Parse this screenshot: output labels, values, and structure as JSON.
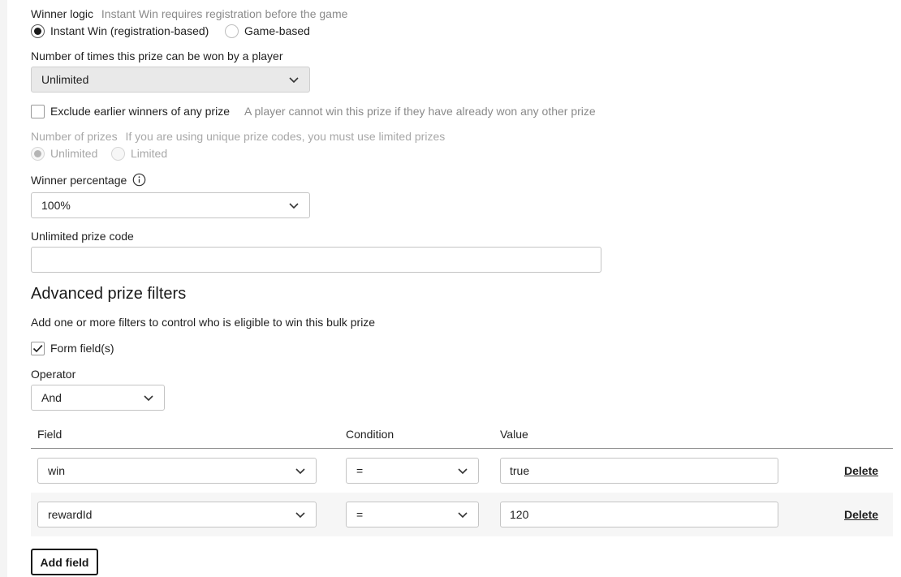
{
  "winner_logic": {
    "label": "Winner logic",
    "hint": "Instant Win requires registration before the game",
    "options": [
      "Instant Win (registration-based)",
      "Game-based"
    ],
    "selected": "Instant Win (registration-based)"
  },
  "times_won": {
    "label": "Number of times this prize can be won by a player",
    "value": "Unlimited"
  },
  "exclude_earlier": {
    "label": "Exclude earlier winners of any prize",
    "hint": "A player cannot win this prize if they have already won any other prize",
    "checked": false
  },
  "number_of_prizes": {
    "label": "Number of prizes",
    "hint": "If you are using unique prize codes, you must use limited prizes",
    "options": [
      "Unlimited",
      "Limited"
    ],
    "selected": "Unlimited",
    "disabled": true
  },
  "winner_percentage": {
    "label": "Winner percentage",
    "value": "100%"
  },
  "prize_code": {
    "label": "Unlimited prize code",
    "value": ""
  },
  "advanced": {
    "title": "Advanced prize filters",
    "description": "Add one or more filters to control who is eligible to win this bulk prize",
    "form_fields_label": "Form field(s)",
    "form_fields_checked": true,
    "operator_label": "Operator",
    "operator_value": "And"
  },
  "filters_table": {
    "headers": [
      "Field",
      "Condition",
      "Value"
    ],
    "rows": [
      {
        "field": "win",
        "condition": "=",
        "value": "true",
        "action": "Delete"
      },
      {
        "field": "rewardId",
        "condition": "=",
        "value": "120",
        "action": "Delete"
      }
    ],
    "add_label": "Add field"
  },
  "colors": {
    "row_alt": "#f6f6f6",
    "disabled_text": "#a8a8a8"
  }
}
